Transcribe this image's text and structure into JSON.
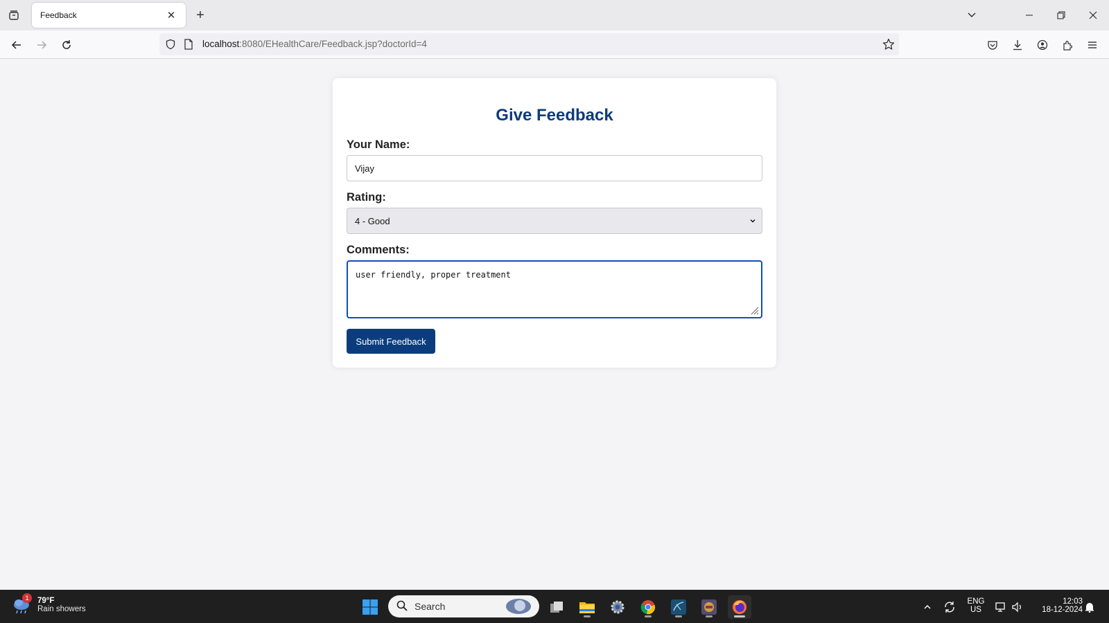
{
  "browser": {
    "tab_title": "Feedback",
    "url_host": "localhost",
    "url_rest": ":8080/EHealthCare/Feedback.jsp?doctorId=4"
  },
  "page": {
    "heading": "Give Feedback",
    "name_label": "Your Name:",
    "name_value": "Vijay",
    "rating_label": "Rating:",
    "rating_selected": "4 - Good",
    "comments_label": "Comments:",
    "comments_value": "user friendly, proper treatment",
    "submit_label": "Submit Feedback",
    "accent_color": "#0d3c7a"
  },
  "taskbar": {
    "weather_badge": "1",
    "weather_temp": "79°F",
    "weather_desc": "Rain showers",
    "search_placeholder": "Search",
    "lang_top": "ENG",
    "lang_bottom": "US",
    "time": "12:03",
    "date": "18-12-2024"
  }
}
